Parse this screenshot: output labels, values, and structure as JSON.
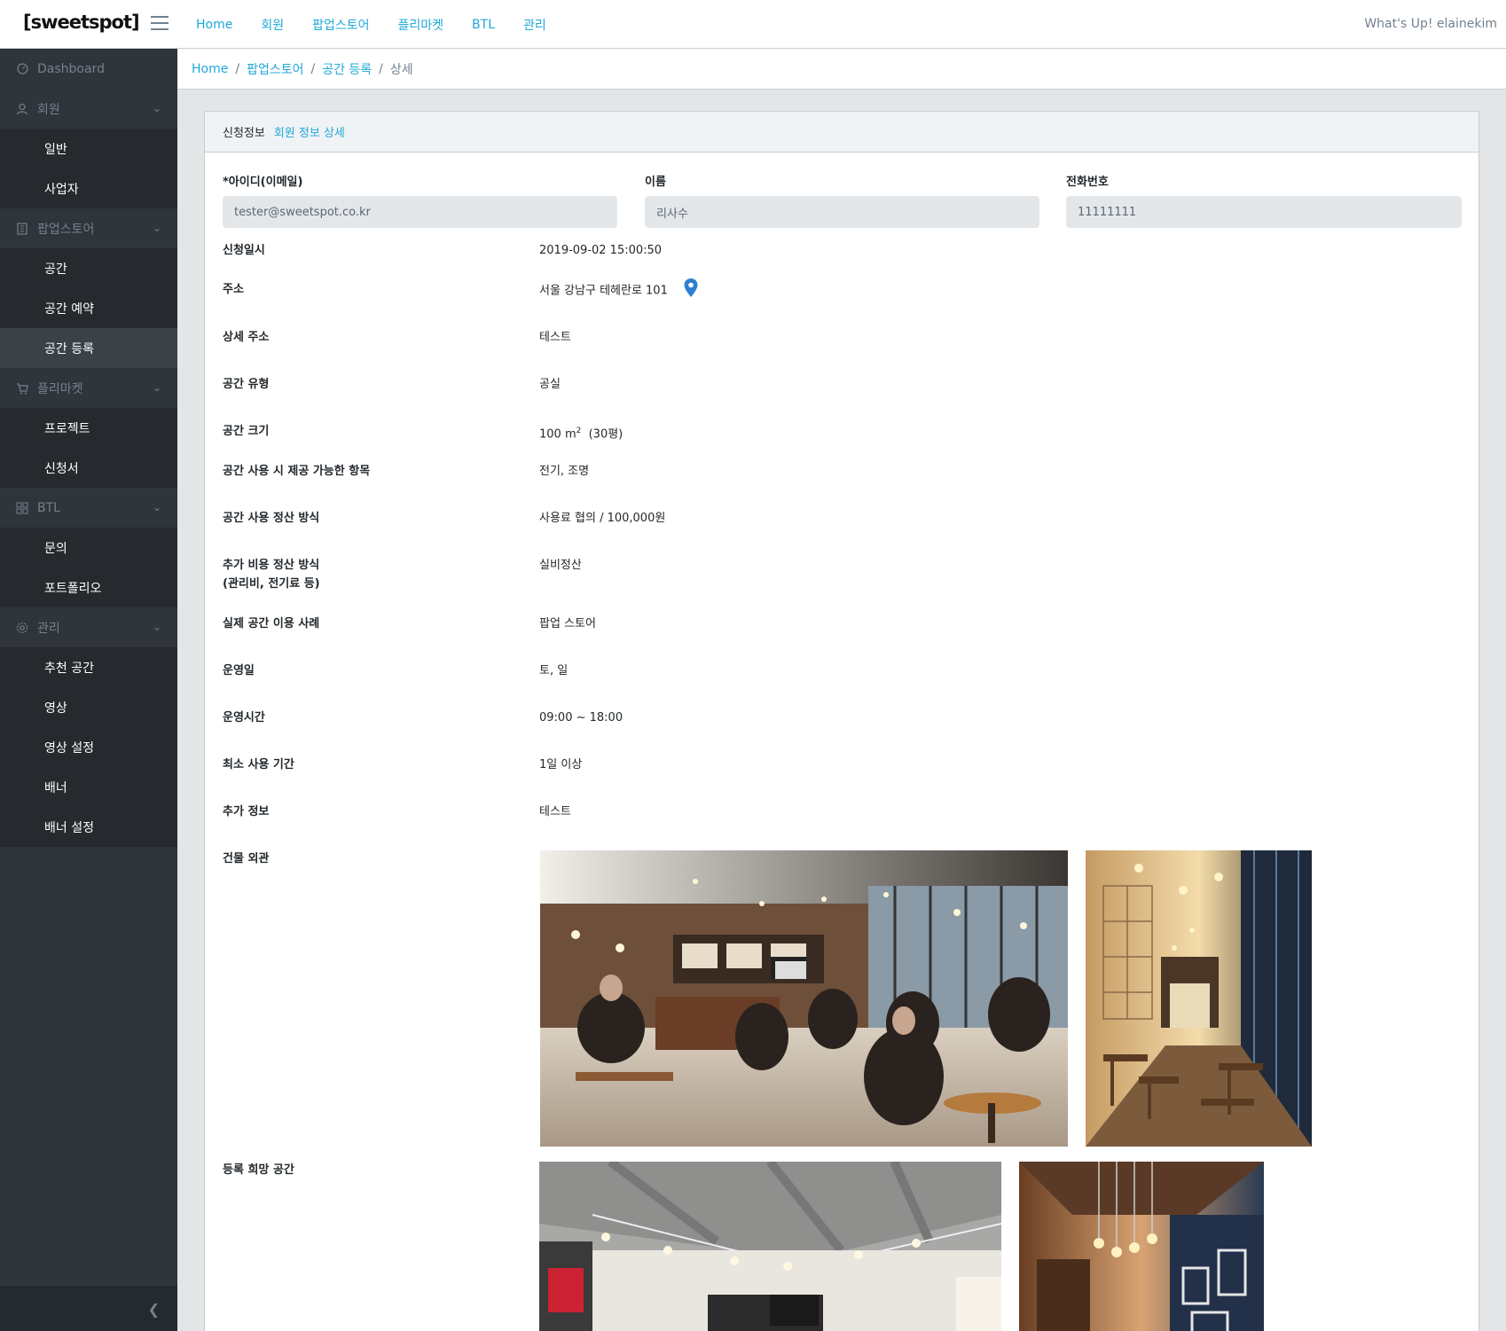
{
  "header": {
    "logo": "[sweetspot]",
    "nav": [
      "Home",
      "회원",
      "팝업스토어",
      "플리마켓",
      "BTL",
      "관리"
    ],
    "greeting": "What's Up! elainekim"
  },
  "sidebar": {
    "dashboard": "Dashboard",
    "sections": [
      {
        "label": "회원",
        "icon": "user-icon",
        "items": [
          "일반",
          "사업자"
        ]
      },
      {
        "label": "팝업스토어",
        "icon": "building-icon",
        "items": [
          "공간",
          "공간 예약",
          "공간 등록"
        ]
      },
      {
        "label": "플리마켓",
        "icon": "cart-icon",
        "items": [
          "프로젝트",
          "신청서"
        ]
      },
      {
        "label": "BTL",
        "icon": "grid-icon",
        "items": [
          "문의",
          "포트폴리오"
        ]
      },
      {
        "label": "관리",
        "icon": "gear-icon",
        "items": [
          "추천 공간",
          "영상",
          "영상 설정",
          "배너",
          "배너 설정"
        ]
      }
    ],
    "active_item": "공간 등록"
  },
  "breadcrumb": {
    "items": [
      "Home",
      "팝업스토어",
      "공간 등록"
    ],
    "current": "상세"
  },
  "card": {
    "title": "신청정보",
    "link": "회원 정보 상세"
  },
  "fields": {
    "id_label": "*아이디(이메일)",
    "id_value": "tester@sweetspot.co.kr",
    "name_label": "이름",
    "name_value": "리사수",
    "phone_label": "전화번호",
    "phone_value": "11111111"
  },
  "rows": {
    "applied_at_label": "신청일시",
    "applied_at": "2019-09-02 15:00:50",
    "address_label": "주소",
    "address": "서울 강남구 테헤란로 101",
    "detail_address_label": "상세 주소",
    "detail_address": "테스트",
    "space_type_label": "공간 유형",
    "space_type": "공실",
    "space_size_label": "공간 크기",
    "space_size_num": "100 m",
    "space_size_sup": "2",
    "space_size_py": "(30평)",
    "provided_label": "공간 사용 시 제공 가능한 항목",
    "provided": "전기, 조명",
    "settlement_label": "공간 사용 정산 방식",
    "settlement": "사용료 협의 / 100,000원",
    "extra_cost_label_1": "추가 비용 정산 방식",
    "extra_cost_label_2": "(관리비, 전기료 등)",
    "extra_cost": "실비정산",
    "case_label": "실제 공간 이용 사례",
    "case": "팝업 스토어",
    "op_days_label": "운영일",
    "op_days": "토, 일",
    "op_hours_label": "운영시간",
    "op_hours": "09:00 ~ 18:00",
    "min_period_label": "최소 사용 기간",
    "min_period": "1일 이상",
    "extra_info_label": "추가 정보",
    "extra_info": "테스트",
    "exterior_label": "건물 외관",
    "desired_label": "등록 희망 공간"
  },
  "colors": {
    "accent": "#20a8d8",
    "sidebar_bg": "#2f353a",
    "pin": "#2f7fd0"
  }
}
